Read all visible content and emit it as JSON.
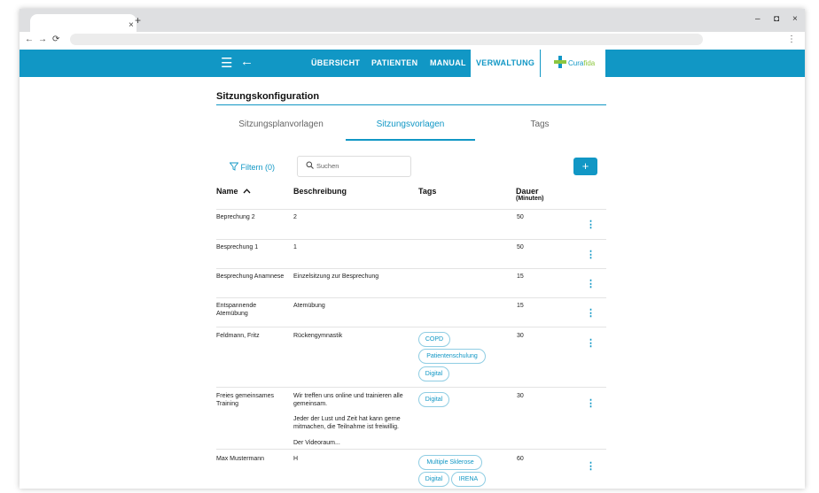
{
  "browser": {
    "tab_close": "×",
    "new_tab": "+",
    "back": "←",
    "forward": "→",
    "reload": "⟳",
    "menu": "⋮",
    "min": "–",
    "max": "◘",
    "close": "×"
  },
  "appbar": {
    "menu_icon": "☰",
    "back_icon": "←",
    "nav": [
      "ÜBERSICHT",
      "PATIENTEN",
      "MANUAL",
      "VERWALTUNG"
    ],
    "logo": {
      "part1": "Cura",
      "part2": "fida"
    }
  },
  "page": {
    "title": "Sitzungskonfiguration",
    "tabs": [
      "Sitzungsplanvorlagen",
      "Sitzungsvorlagen",
      "Tags"
    ],
    "filter_label": "Filtern (0)",
    "search_placeholder": "Suchen",
    "add_label": "+"
  },
  "table": {
    "headers": {
      "name": "Name",
      "sort_icon": "^",
      "description": "Beschreibung",
      "tags": "Tags",
      "duration": "Dauer",
      "duration_unit": "(Minuten)"
    },
    "rows": [
      {
        "name": "Beprechung 2",
        "description": "2",
        "tags": [],
        "duration": "50"
      },
      {
        "name": "Besprechung 1",
        "description": "1",
        "tags": [],
        "duration": "50"
      },
      {
        "name": "Besprechung Anamnese",
        "description": "Einzelsitzung zur Besprechung",
        "tags": [],
        "duration": "15"
      },
      {
        "name": "Entspannende Atemübung",
        "description": "Atemübung",
        "tags": [],
        "duration": "15"
      },
      {
        "name": "Feldmann, Fritz",
        "description": "Rückengymnastik",
        "tags": [
          "COPD",
          "Patientenschulung",
          "Digital"
        ],
        "duration": "30"
      },
      {
        "name": "Freies gemeinsames Training",
        "description": "Wir treffen uns online und trainieren alle gemeinsam.",
        "description_2": "Jeder der Lust und Zeit hat kann gerne mitmachen, die Teilnahme ist freiwillig.",
        "description_3": "Der Videoraum...",
        "tags": [
          "Digital"
        ],
        "duration": "30"
      },
      {
        "name": "Max Mustermann",
        "description": "H",
        "tags": [
          "Multiple Sklerose",
          "Digital",
          "IRENA"
        ],
        "duration": "60"
      }
    ],
    "row_menu": "⋮"
  }
}
